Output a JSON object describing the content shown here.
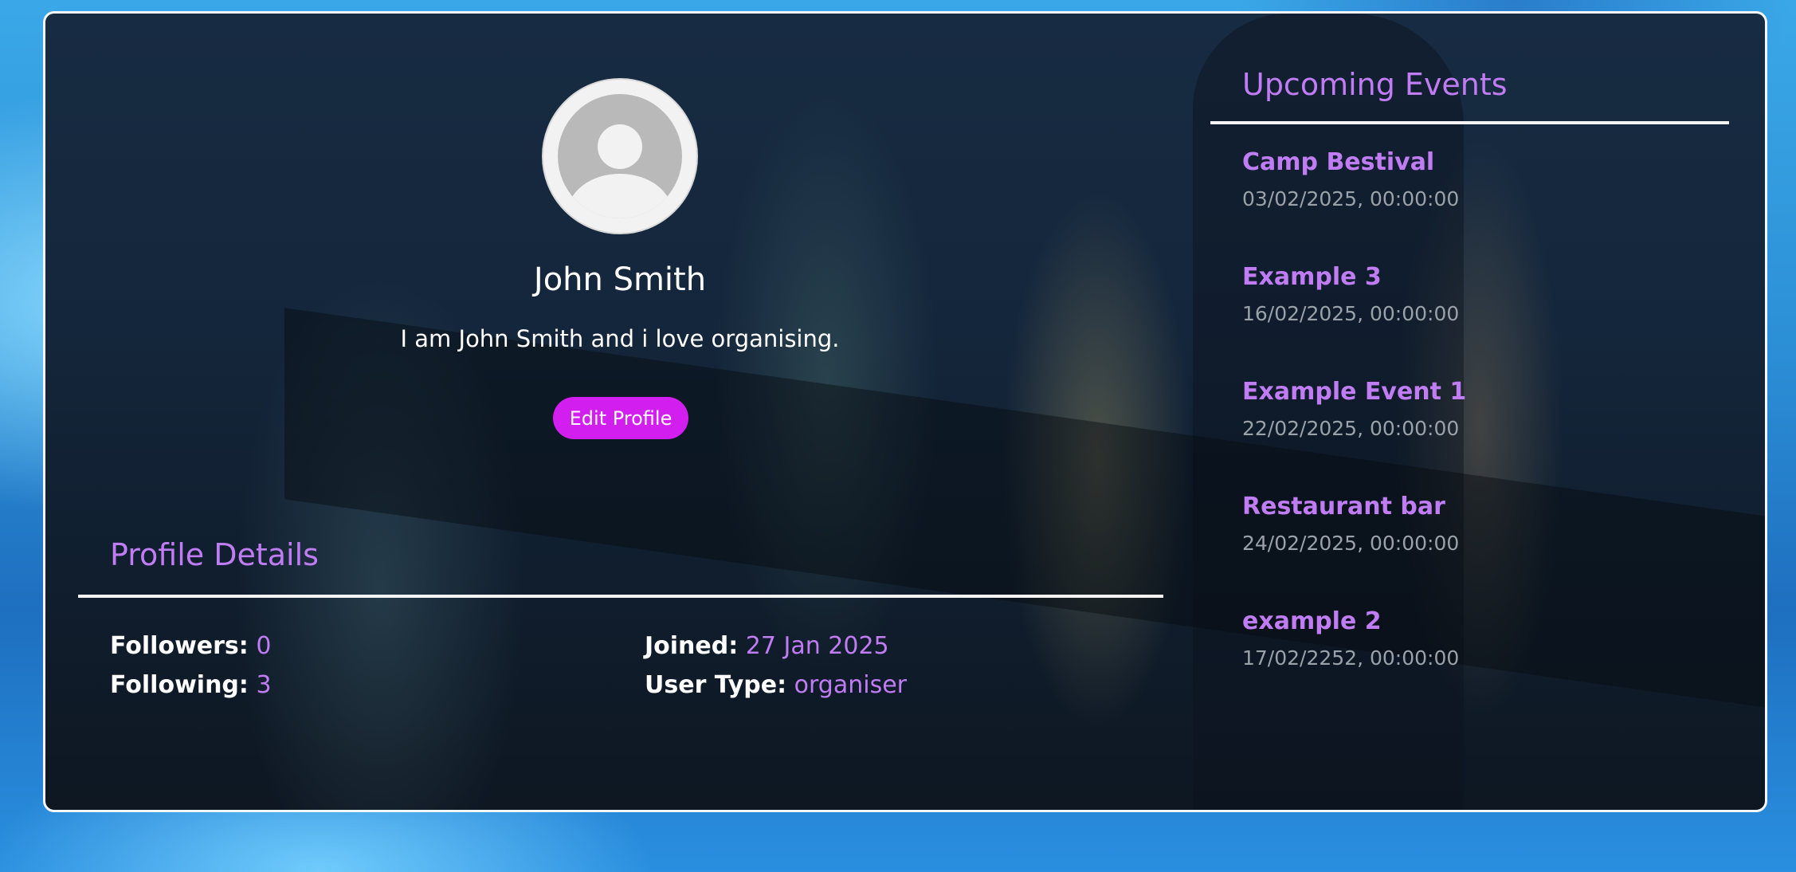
{
  "profile": {
    "name": "John Smith",
    "bio": "I am John Smith and i love organising.",
    "edit_button": "Edit Profile"
  },
  "details": {
    "title": "Profile Details",
    "followers_label": "Followers:",
    "followers_value": "0",
    "following_label": "Following:",
    "following_value": "3",
    "joined_label": "Joined:",
    "joined_value": "27 Jan 2025",
    "user_type_label": "User Type:",
    "user_type_value": "organiser"
  },
  "events": {
    "title": "Upcoming Events",
    "items": [
      {
        "name": "Camp Bestival",
        "date": "03/02/2025, 00:00:00"
      },
      {
        "name": "Example 3",
        "date": "16/02/2025, 00:00:00"
      },
      {
        "name": "Example Event 1",
        "date": "22/02/2025, 00:00:00"
      },
      {
        "name": "Restaurant bar",
        "date": "24/02/2025, 00:00:00"
      },
      {
        "name": "example 2",
        "date": "17/02/2252, 00:00:00"
      }
    ]
  },
  "colors": {
    "accent": "#c07cf2",
    "button": "#d21ff0",
    "text": "#ffffff",
    "muted": "#9aa1a8"
  },
  "icons": {
    "avatar": "default-user-avatar-icon"
  }
}
